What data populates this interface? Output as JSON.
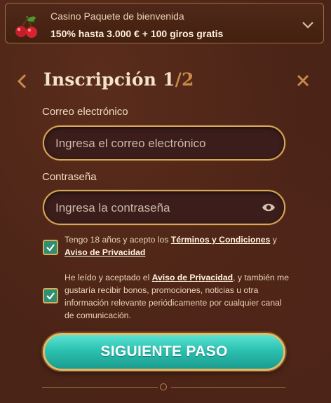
{
  "promo": {
    "title": "Casino Paquete de bienvenida",
    "offer": "150% hasta 3.000 € + 100 giros gratis",
    "icon": "cherry-icon",
    "toggle_icon": "chevron-down-icon"
  },
  "header": {
    "title": "Inscripción",
    "step_current": "1",
    "step_total": "/2",
    "back_icon": "chevron-left-icon",
    "close_icon": "close-icon"
  },
  "form": {
    "email": {
      "label": "Correo electrónico",
      "placeholder": "Ingresa el correo electrónico",
      "value": ""
    },
    "password": {
      "label": "Contraseña",
      "placeholder": "Ingresa la contraseña",
      "value": "",
      "toggle_icon": "eye-icon"
    },
    "consent_terms": {
      "checked": true,
      "text_before": "Tengo 18 años y acepto los ",
      "link1": "Términos y Condiciones",
      "text_middle": " y",
      "link2": "Aviso de Privacidad"
    },
    "consent_marketing": {
      "checked": true,
      "text_before": "He leído y aceptado el ",
      "link": "Aviso de Privacidad",
      "text_after": ", y también me gustaría recibir bonos, promociones, noticias u otra información relevante periódicamente por cualquier canal de comunicación."
    },
    "submit_label": "SIGUIENTE PASO"
  },
  "colors": {
    "background": "#4a2417",
    "accent_gold": "#d7a857",
    "button_teal": "#2cc1b0",
    "checkbox_green": "#2f8f6e",
    "step_total": "#c8894a"
  }
}
